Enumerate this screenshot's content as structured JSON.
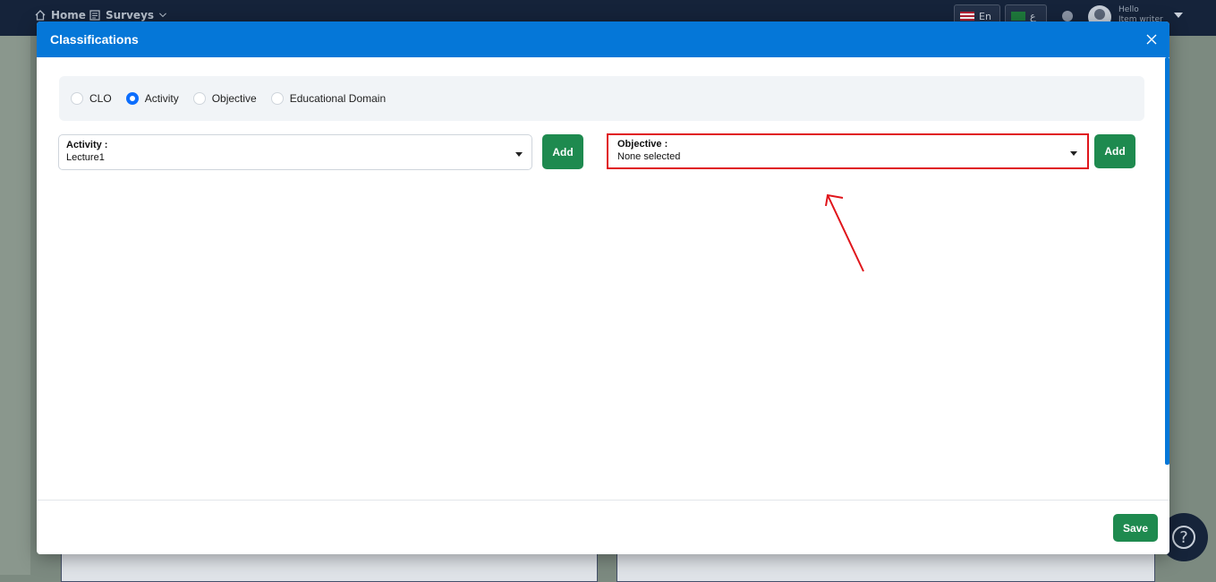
{
  "topbar": {
    "home_label": "Home",
    "surveys_label": "Surveys",
    "lang_en_label": "En",
    "lang_ar_label": "ع",
    "hello_label": "Hello",
    "user_name": "Item writer"
  },
  "modal": {
    "title": "Classifications",
    "radio_options": [
      {
        "label": "CLO",
        "checked": false
      },
      {
        "label": "Activity",
        "checked": true
      },
      {
        "label": "Objective",
        "checked": false
      },
      {
        "label": "Educational Domain",
        "checked": false
      }
    ],
    "activity_select": {
      "label": "Activity :",
      "value": "Lecture1"
    },
    "objective_select": {
      "label": "Objective :",
      "value": "None selected"
    },
    "add_label": "Add",
    "save_label": "Save"
  },
  "help": {
    "icon": "?"
  },
  "colors": {
    "header_blue": "#0577d8",
    "button_green": "#1e8a4f",
    "annotation_red": "#e0151b",
    "radio_checked": "#0d6efd"
  }
}
